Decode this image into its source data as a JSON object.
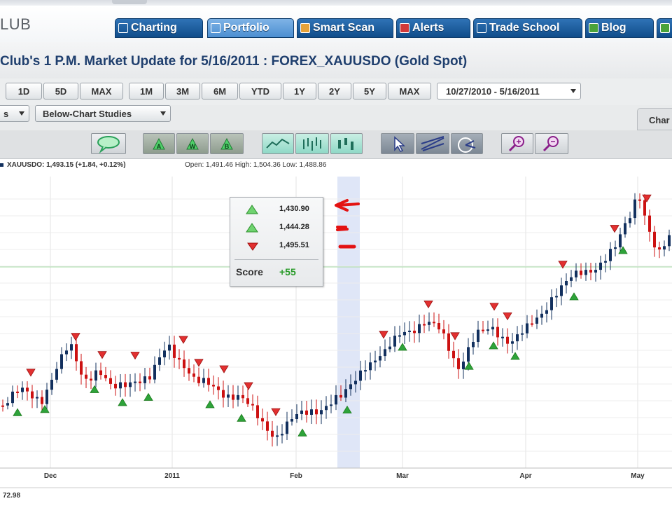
{
  "header": {
    "logo_text": "LUB",
    "tabs": [
      {
        "label": "Charting",
        "icon": "charting-icon",
        "active": false
      },
      {
        "label": "Portfolio",
        "icon": "portfolio-icon",
        "active": true
      },
      {
        "label": "Smart Scan",
        "icon": "smart-scan-icon",
        "active": false
      },
      {
        "label": "Alerts",
        "icon": "alerts-icon",
        "active": false
      },
      {
        "label": "Trade School",
        "icon": "trade-school-icon",
        "active": false
      },
      {
        "label": "Blog",
        "icon": "blog-icon",
        "active": false
      }
    ]
  },
  "page_title": "Club's 1 P.M. Market Update for 5/16/2011 : FOREX_XAUUSDO (Gold Spot)",
  "range_buttons": [
    "1D",
    "5D",
    "MAX",
    "1M",
    "3M",
    "6M",
    "YTD",
    "1Y",
    "2Y",
    "5Y",
    "MAX"
  ],
  "date_range": "10/27/2010 - 5/16/2011",
  "studies": {
    "left_select_label": "s",
    "below_chart_label": "Below-Chart Studies",
    "chart_tab_label": "Char"
  },
  "toolbar_icons": [
    "comment-icon",
    "signal-a-icon",
    "signal-w-icon",
    "signal-b-icon",
    "line-chart-icon",
    "bar-chart-icon",
    "candle-chart-icon",
    "pointer-icon",
    "trendline-icon",
    "fibonacci-icon",
    "zoom-in-icon",
    "zoom-out-icon"
  ],
  "quote": {
    "symbol_text": "XAUUSDO: 1,493.15 (+1.84, +0.12%)",
    "ohlc_text": "Open: 1,491.46  High: 1,504.36  Low: 1,488.86"
  },
  "score_box": {
    "rows": [
      {
        "signal": "up",
        "value": "1,430.90"
      },
      {
        "signal": "up",
        "value": "1,444.28"
      },
      {
        "signal": "down",
        "value": "1,495.51"
      }
    ],
    "score_label": "Score",
    "score_value": "+55"
  },
  "x_axis_labels": [
    "Dec",
    "2011",
    "Feb",
    "Mar",
    "Apr",
    "May"
  ],
  "bottom_value": "72.98",
  "colors": {
    "tab_blue": "#1b5a9a",
    "candle_up": "#12305e",
    "candle_down": "#cc1111",
    "signal_up": "#2ea33a",
    "signal_down": "#e23030",
    "highlight_band": "#dfe6f7",
    "score_positive": "#2a9b2a"
  }
}
